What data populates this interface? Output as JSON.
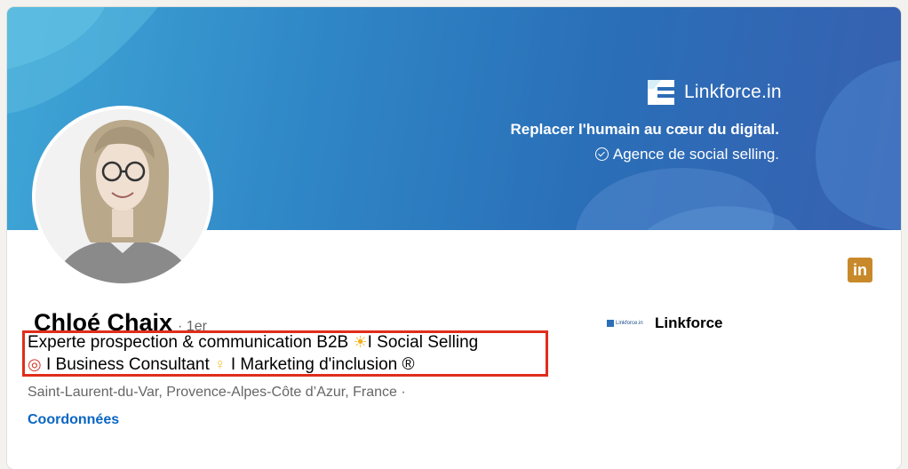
{
  "banner": {
    "brand_name": "Linkforce.in",
    "tagline_1": "Replacer l'humain au cœur du digital.",
    "tagline_2": "Agence de social selling."
  },
  "profile": {
    "name": "Chloé Chaix",
    "degree": "· 1er",
    "headline_line1_a": "Experte prospection & communication B2B ",
    "headline_line1_b": "I Social Selling",
    "headline_line2_a": " I Business Consultant ",
    "headline_line2_b": " I Marketing d'inclusion ®",
    "location": "Saint-Laurent-du-Var, Provence-Alpes-Côte d’Azur, France ·",
    "contact_link": "Coordonnées"
  },
  "company": {
    "logo_text": "Linkforce.in",
    "name": "Linkforce"
  },
  "icons": {
    "linkedin": "linkedin-icon",
    "sun": "sun-emoji-icon",
    "target": "target-emoji-icon",
    "bulb": "lightbulb-emoji-icon"
  },
  "colors": {
    "highlight_border": "#e02d1c",
    "link": "#0a66c2",
    "linkedin_badge": "#c8892a"
  }
}
